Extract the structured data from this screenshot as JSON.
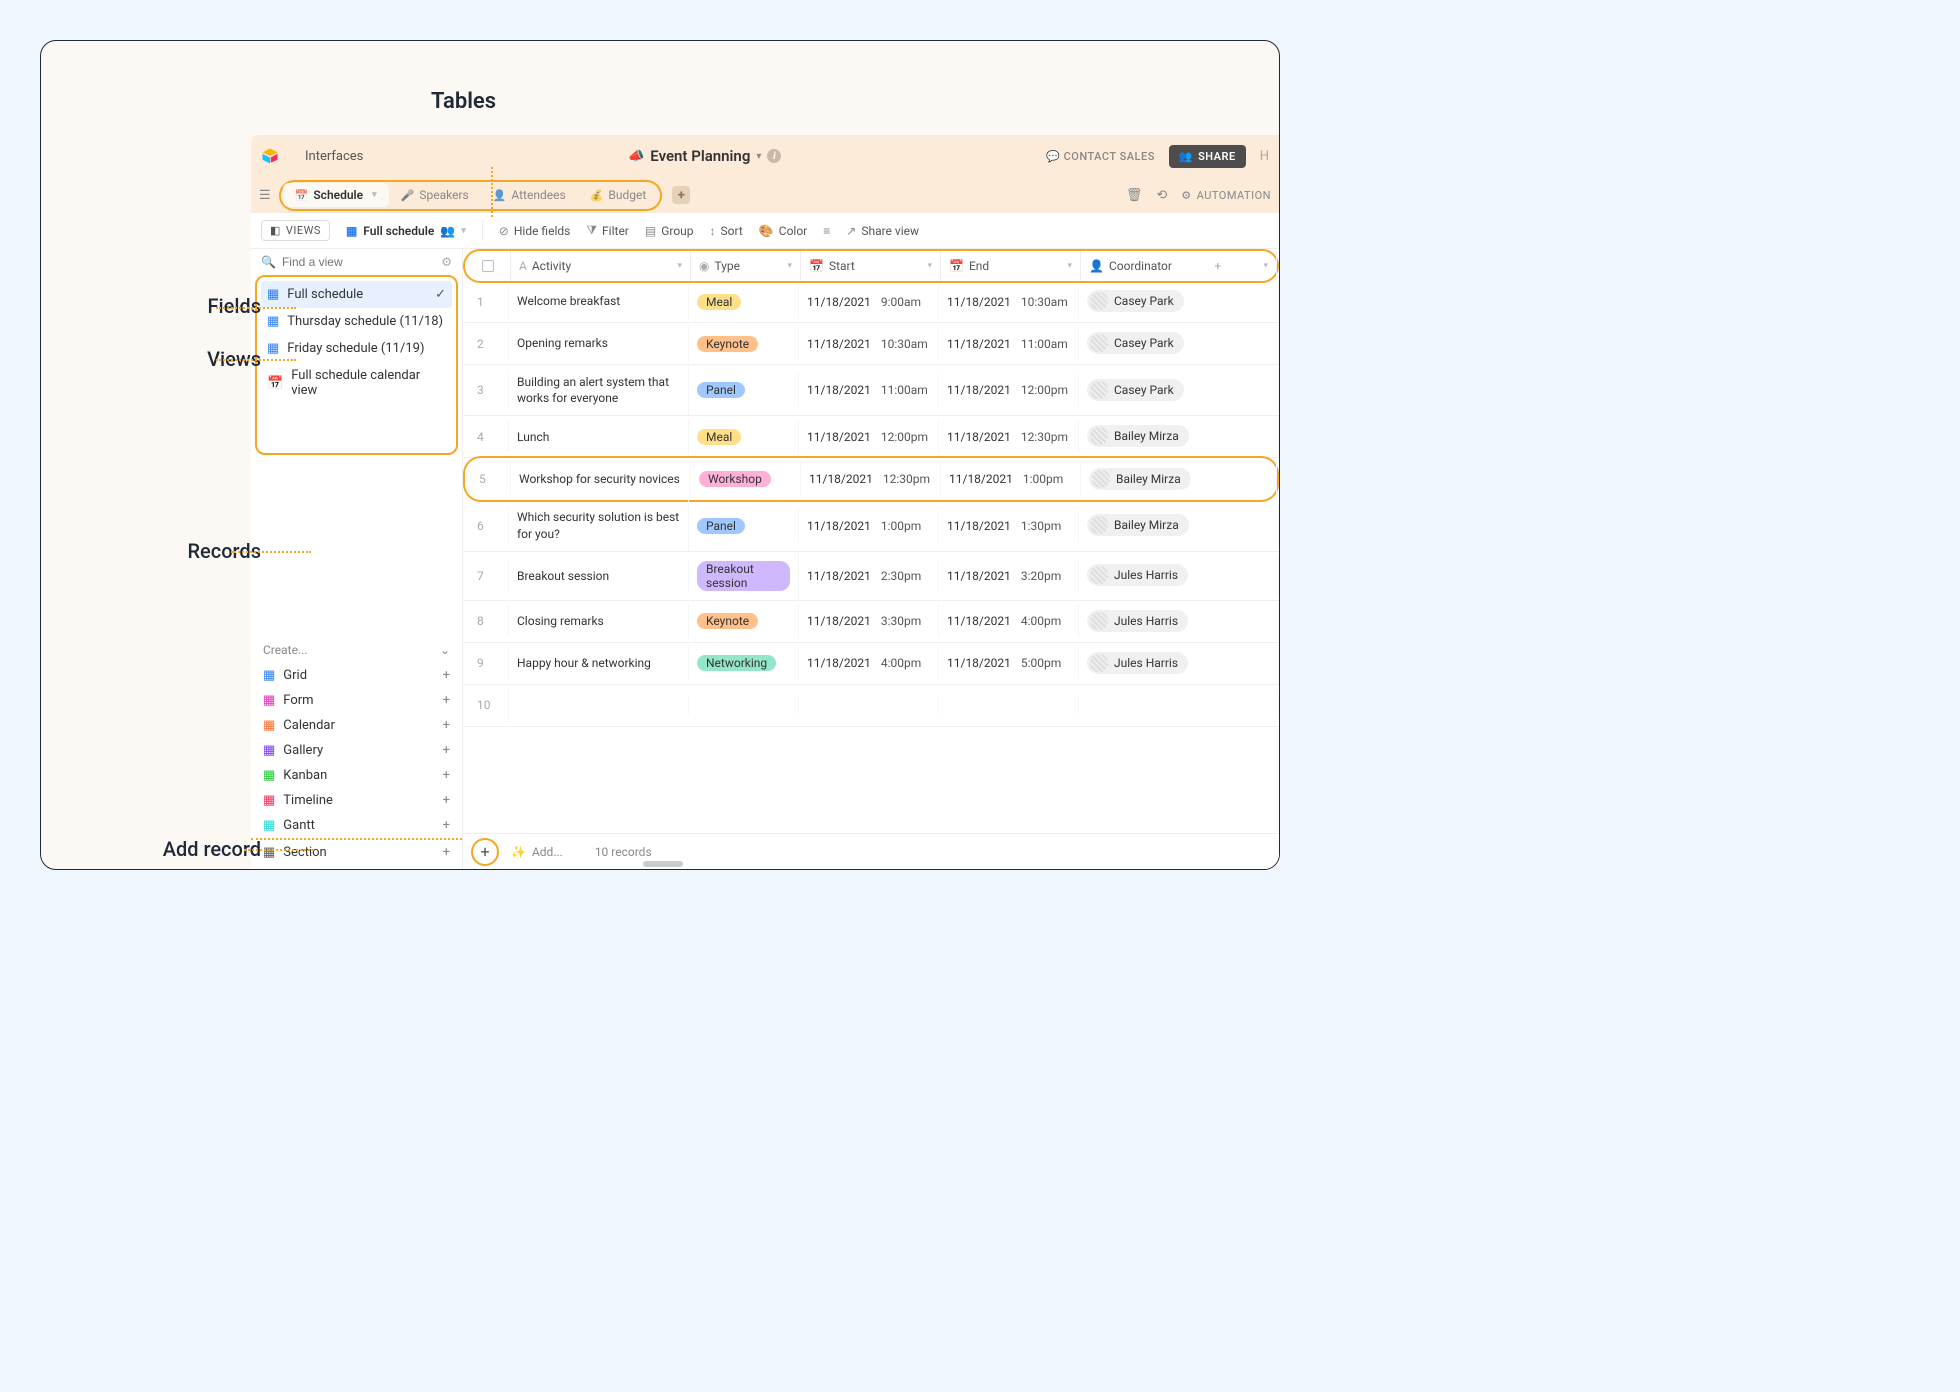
{
  "annotations": {
    "tables": "Tables",
    "fields": "Fields",
    "views": "Views",
    "records": "Records",
    "add_record": "Add record"
  },
  "header": {
    "interfaces": "Interfaces",
    "app_name": "Event Planning",
    "contact_sales": "CONTACT SALES",
    "share": "SHARE"
  },
  "tabs": [
    {
      "icon": "📅",
      "label": "Schedule",
      "active": true
    },
    {
      "icon": "🎤",
      "label": "Speakers",
      "active": false
    },
    {
      "icon": "👤",
      "label": "Attendees",
      "active": false
    },
    {
      "icon": "💰",
      "label": "Budget",
      "active": false
    }
  ],
  "automation_label": "AUTOMATION",
  "toolbar": {
    "views_btn": "VIEWS",
    "view_name": "Full schedule",
    "hide_fields": "Hide fields",
    "filter": "Filter",
    "group": "Group",
    "sort": "Sort",
    "color": "Color",
    "share_view": "Share view"
  },
  "sidebar": {
    "find_placeholder": "Find a view",
    "views": [
      {
        "icon": "grid",
        "label": "Full schedule",
        "active": true
      },
      {
        "icon": "grid",
        "label": "Thursday schedule (11/18)",
        "active": false
      },
      {
        "icon": "grid",
        "label": "Friday schedule (11/19)",
        "active": false
      },
      {
        "icon": "cal",
        "label": "Full schedule calendar view",
        "active": false
      }
    ],
    "create_label": "Create...",
    "create_items": [
      {
        "cls": "ci-grid",
        "label": "Grid"
      },
      {
        "cls": "ci-form",
        "label": "Form"
      },
      {
        "cls": "ci-cal",
        "label": "Calendar"
      },
      {
        "cls": "ci-gal",
        "label": "Gallery"
      },
      {
        "cls": "ci-kan",
        "label": "Kanban"
      },
      {
        "cls": "ci-time",
        "label": "Timeline"
      },
      {
        "cls": "ci-gantt",
        "label": "Gantt"
      },
      {
        "cls": "ci-sec",
        "label": "Section"
      }
    ]
  },
  "columns": {
    "activity": "Activity",
    "type": "Type",
    "start": "Start",
    "end": "End",
    "coordinator": "Coordinator"
  },
  "rows": [
    {
      "n": "1",
      "activity": "Welcome breakfast",
      "type": "Meal",
      "type_cls": "meal",
      "sd": "11/18/2021",
      "st": "9:00am",
      "ed": "11/18/2021",
      "et": "10:30am",
      "coord": "Casey Park"
    },
    {
      "n": "2",
      "activity": "Opening remarks",
      "type": "Keynote",
      "type_cls": "keynote",
      "sd": "11/18/2021",
      "st": "10:30am",
      "ed": "11/18/2021",
      "et": "11:00am",
      "coord": "Casey Park"
    },
    {
      "n": "3",
      "activity": "Building an alert system that works for everyone",
      "type": "Panel",
      "type_cls": "panel",
      "sd": "11/18/2021",
      "st": "11:00am",
      "ed": "11/18/2021",
      "et": "12:00pm",
      "coord": "Casey Park"
    },
    {
      "n": "4",
      "activity": "Lunch",
      "type": "Meal",
      "type_cls": "meal",
      "sd": "11/18/2021",
      "st": "12:00pm",
      "ed": "11/18/2021",
      "et": "12:30pm",
      "coord": "Bailey Mirza"
    },
    {
      "n": "5",
      "activity": "Workshop for security novices",
      "type": "Workshop",
      "type_cls": "workshop",
      "sd": "11/18/2021",
      "st": "12:30pm",
      "ed": "11/18/2021",
      "et": "1:00pm",
      "coord": "Bailey Mirza",
      "highlighted": true
    },
    {
      "n": "6",
      "activity": "Which security solution is best for you?",
      "type": "Panel",
      "type_cls": "panel",
      "sd": "11/18/2021",
      "st": "1:00pm",
      "ed": "11/18/2021",
      "et": "1:30pm",
      "coord": "Bailey Mirza"
    },
    {
      "n": "7",
      "activity": "Breakout session",
      "type": "Breakout session",
      "type_cls": "breakout",
      "sd": "11/18/2021",
      "st": "2:30pm",
      "ed": "11/18/2021",
      "et": "3:20pm",
      "coord": "Jules Harris"
    },
    {
      "n": "8",
      "activity": "Closing remarks",
      "type": "Keynote",
      "type_cls": "keynote",
      "sd": "11/18/2021",
      "st": "3:30pm",
      "ed": "11/18/2021",
      "et": "4:00pm",
      "coord": "Jules Harris"
    },
    {
      "n": "9",
      "activity": "Happy hour & networking",
      "type": "Networking",
      "type_cls": "networking",
      "sd": "11/18/2021",
      "st": "4:00pm",
      "ed": "11/18/2021",
      "et": "5:00pm",
      "coord": "Jules Harris"
    },
    {
      "n": "10",
      "activity": "",
      "type": "",
      "sd": "",
      "st": "",
      "ed": "",
      "et": "",
      "coord": ""
    }
  ],
  "footer": {
    "add_label": "Add...",
    "count": "10 records"
  }
}
